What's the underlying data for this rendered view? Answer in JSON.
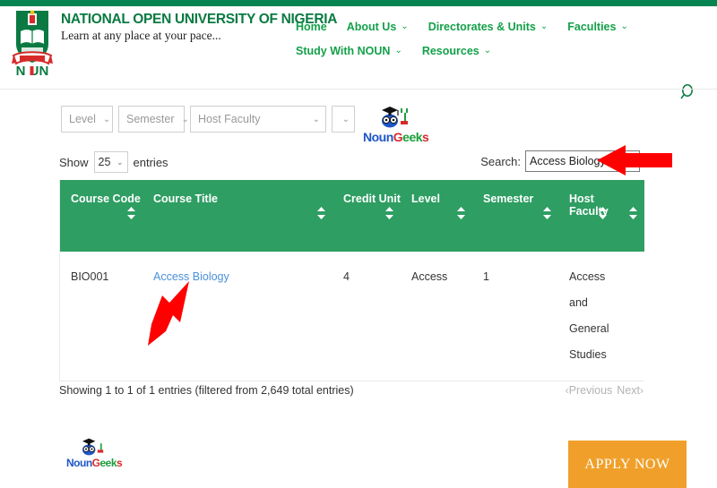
{
  "site": {
    "brand_title": "NATIONAL OPEN UNIVERSITY OF NIGERIA",
    "brand_tagline": "Learn at any place at your pace...",
    "logo_name": "noun-crest-logo",
    "accent_green": "#058451",
    "nav_green": "#13a049",
    "table_header_green": "#2e9e63",
    "link_blue": "#4a90d9",
    "apply_orange": "#f0a02a",
    "annotation_red": "#ff0000"
  },
  "nav": {
    "row1": [
      {
        "label": "Home",
        "caret": ""
      },
      {
        "label": "About Us",
        "caret": "⌄"
      },
      {
        "label": "Directorates & Units",
        "caret": "⌄"
      },
      {
        "label": "Faculties",
        "caret": "⌄"
      }
    ],
    "row2": [
      {
        "label": "Study With NOUN",
        "caret": "⌄"
      },
      {
        "label": "Resources",
        "caret": "⌄"
      }
    ],
    "search_icon": "search-icon"
  },
  "filters": {
    "level": {
      "value": "Level",
      "chevron": "⌄"
    },
    "semester": {
      "value": "Semester",
      "chevron": "⌄"
    },
    "host_faculty": {
      "value": "Host Faculty",
      "chevron": "⌄"
    },
    "extra": {
      "value": "",
      "chevron": "⌄"
    }
  },
  "watermark": {
    "part1": "Noun",
    "part2": "G",
    "part3": "eek",
    "part4": "s",
    "name": "noungeeks-logo"
  },
  "controls": {
    "show_label": "Show",
    "entries_value": "25",
    "entries_chevron": "⌄",
    "entries_label": "entries",
    "search_label": "Search:",
    "search_value": "Access Biology",
    "search_placeholder": ""
  },
  "table": {
    "columns": [
      {
        "label": "Course Code",
        "sortable": true
      },
      {
        "label": "Course Title",
        "sortable": true
      },
      {
        "label": "Credit Unit",
        "sortable": true
      },
      {
        "label": "Level",
        "sortable": true
      },
      {
        "label": "Semester",
        "sortable": true
      },
      {
        "label": "Host Faculty",
        "sortable": true
      },
      {
        "label": "",
        "sortable": true
      }
    ],
    "rows": [
      {
        "course_code": "BIO001",
        "course_title": "Access Biology",
        "credit_unit": "4",
        "level": "Access",
        "semester": "1",
        "host_faculty": "Access and General Studies",
        "extra": ""
      }
    ]
  },
  "footer": {
    "info": "Showing 1 to 1 of 1 entries (filtered from 2,649 total entries)",
    "previous_label": "Previous",
    "next_label": "Next",
    "prev_chevron": "‹",
    "next_chevron": "›"
  },
  "bottom": {
    "apply_label": "APPLY NOW"
  },
  "annotations": [
    {
      "name": "arrow-pointing-to-search-box",
      "direction": "left"
    },
    {
      "name": "arrow-pointing-to-course-title-link",
      "direction": "up-right"
    }
  ]
}
